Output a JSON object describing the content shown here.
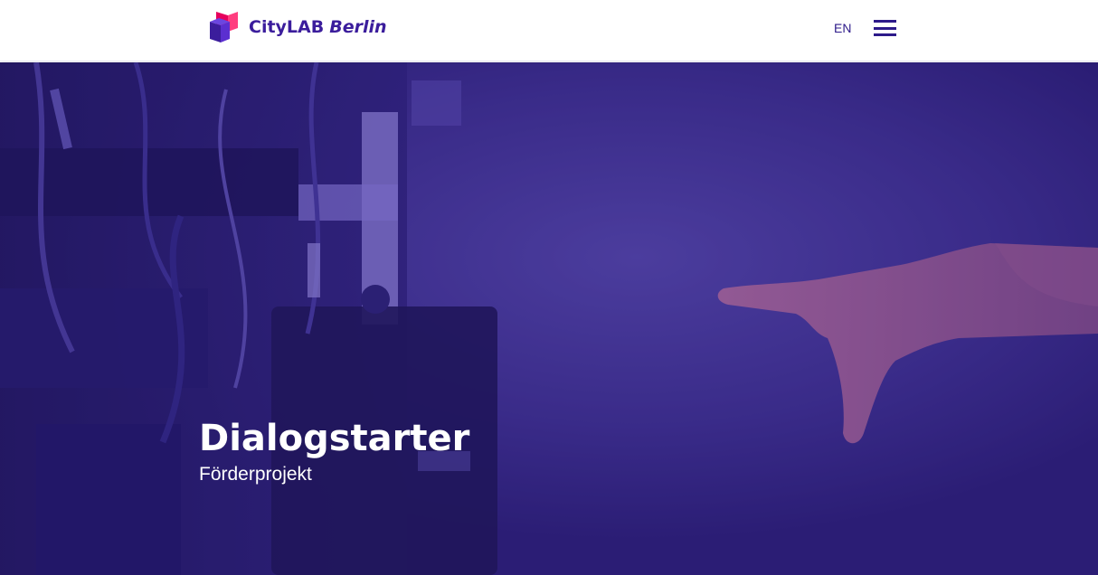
{
  "header": {
    "logo": {
      "brand": "CityLAB",
      "city": "Berlin",
      "icon": "citylab-logo-mark"
    },
    "language_label": "EN",
    "menu_icon": "hamburger-menu-icon"
  },
  "hero": {
    "title": "Dialogstarter",
    "subtitle": "Förderprojekt",
    "overlay_color": "#2f1f7f"
  },
  "colors": {
    "brand_purple": "#3b1d9c",
    "brand_pink": "#e6005c",
    "hero_overlay": "#2f1f7f"
  }
}
